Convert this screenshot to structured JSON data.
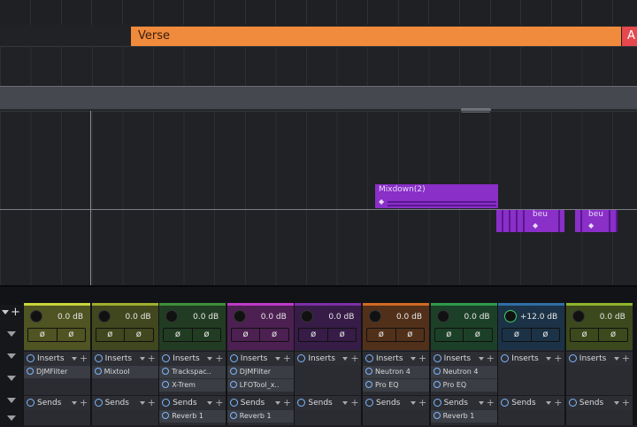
{
  "arranger": {
    "sections": [
      {
        "label": "Verse",
        "color": "#f08a3c"
      },
      {
        "label": "A",
        "color": "#e5484d"
      }
    ]
  },
  "clips": [
    {
      "label": "Mixdown(2)",
      "color": "#8a2fc8"
    },
    {
      "label": "beu",
      "color": "#8a2fc8"
    },
    {
      "label": "beu",
      "color": "#8a2fc8"
    }
  ],
  "mixer": {
    "add_label": "+",
    "inserts_label": "Inserts",
    "sends_label": "Sends",
    "phase_symbol": "ø",
    "channels": [
      {
        "gain": "0.0 dB",
        "color": "#c8d53a",
        "inserts": [
          "DJMFilter"
        ],
        "sends": []
      },
      {
        "gain": "0.0 dB",
        "color": "#9fae2e",
        "inserts": [
          "Mixtool"
        ],
        "sends": []
      },
      {
        "gain": "0.0 dB",
        "color": "#3f8f3a",
        "inserts": [
          "Trackspac..",
          "X-Trem"
        ],
        "sends": [
          "Reverb 1"
        ]
      },
      {
        "gain": "0.0 dB",
        "color": "#c03ac8",
        "inserts": [
          "DJMFilter",
          "LFOTool_x.."
        ],
        "sends": [
          "Reverb 1"
        ]
      },
      {
        "gain": "0.0 dB",
        "color": "#7e2ea6",
        "inserts": [],
        "sends": []
      },
      {
        "gain": "0.0 dB",
        "color": "#d06a22",
        "inserts": [
          "Neutron 4",
          "Pro EQ"
        ],
        "sends": []
      },
      {
        "gain": "0.0 dB",
        "color": "#2f9a4a",
        "inserts": [
          "Neutron 4",
          "Pro EQ"
        ],
        "sends": [
          "Reverb 1"
        ]
      },
      {
        "gain": "+12.0 dB",
        "color": "#2f6fa6",
        "inserts": [],
        "sends": []
      },
      {
        "gain": "0.0 dB",
        "color": "#8fb52c",
        "inserts": [],
        "sends": []
      }
    ]
  }
}
